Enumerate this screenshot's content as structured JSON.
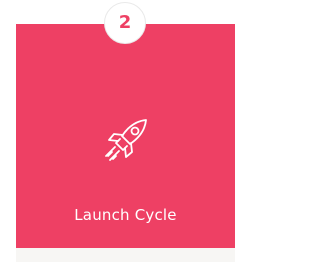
{
  "card": {
    "step_number": "2",
    "title": "Launch Cycle",
    "icon": "rocket-icon"
  },
  "colors": {
    "accent": "#ee4064",
    "badge_bg": "#ffffff",
    "text_on_accent": "#ffffff"
  }
}
